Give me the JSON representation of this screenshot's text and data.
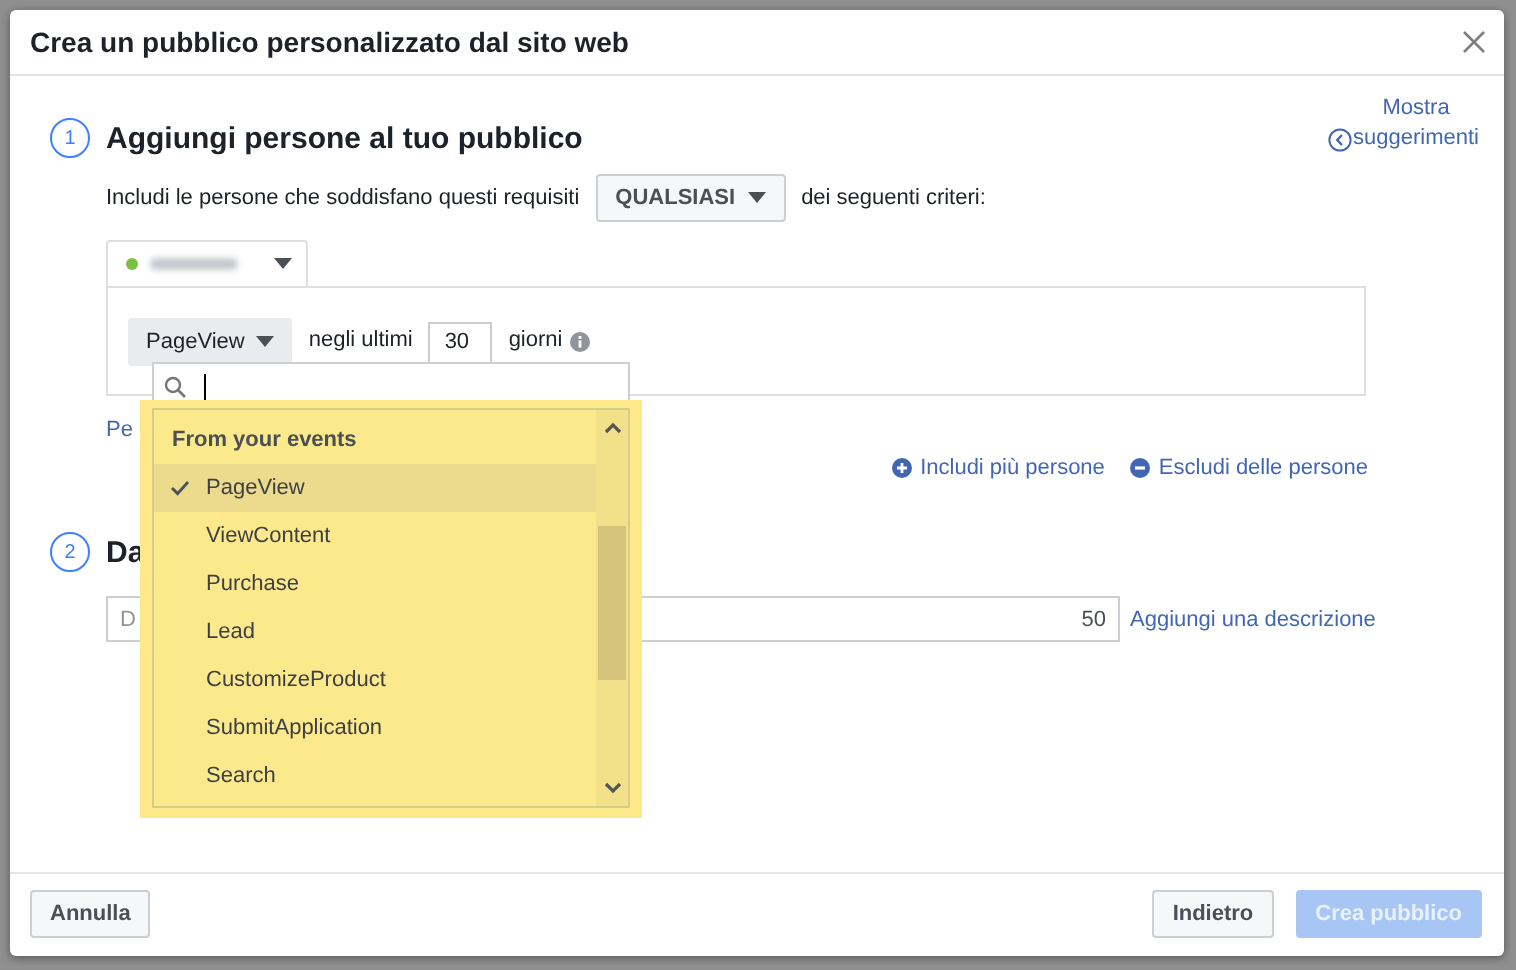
{
  "window": {
    "title": "Crea un pubblico personalizzato dal sito web"
  },
  "suggestions_link": "Mostra suggerimenti",
  "step1": {
    "number": "1",
    "title": "Aggiungi persone al tuo pubblico",
    "rule_prefix": "Includi le persone che soddisfano questi requisiti",
    "match_button": "QUALSIASI",
    "rule_suffix": "dei seguenti criteri:",
    "pixel": {
      "active": true
    }
  },
  "criterion": {
    "event_button": "PageView",
    "within_label": "negli ultimi",
    "days": "30",
    "days_label": "giorni"
  },
  "dropdown": {
    "section": "From your events",
    "items": [
      {
        "label": "PageView",
        "selected": true
      },
      {
        "label": "ViewContent",
        "selected": false
      },
      {
        "label": "Purchase",
        "selected": false
      },
      {
        "label": "Lead",
        "selected": false
      },
      {
        "label": "CustomizeProduct",
        "selected": false
      },
      {
        "label": "SubmitApplication",
        "selected": false
      },
      {
        "label": "Search",
        "selected": false
      }
    ]
  },
  "covered_link": "Pe",
  "include_link": "Includi più persone",
  "exclude_link": "Escludi delle persone",
  "step2": {
    "number": "2",
    "title": "Da",
    "name_placeholder": "D",
    "char_count": "50",
    "description_link": "Aggiungi una descrizione"
  },
  "footer": {
    "cancel": "Annulla",
    "back": "Indietro",
    "create": {
      "label": "Crea pubblico",
      "disabled": true
    }
  }
}
